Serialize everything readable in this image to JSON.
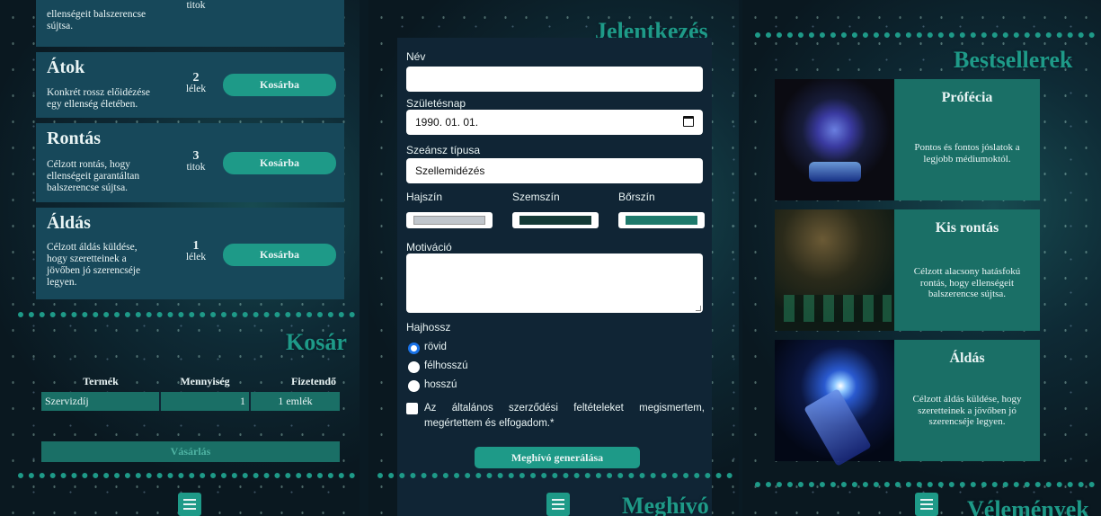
{
  "left": {
    "partial_card": {
      "desc": "ellenségeit balszerencse sújtsa.",
      "qty_unit": "titok"
    },
    "products": [
      {
        "name": "Átok",
        "desc": "Konkrét rossz előidézése egy ellenség életében.",
        "qty": "2",
        "unit": "lélek",
        "button": "Kosárba"
      },
      {
        "name": "Rontás",
        "desc": "Célzott rontás, hogy ellenségeit garantáltan balszerencse sújtsa.",
        "qty": "3",
        "unit": "titok",
        "button": "Kosárba"
      },
      {
        "name": "Áldás",
        "desc": "Célzott áldás küldése, hogy szeretteinek a jövőben jó szerencséje legyen.",
        "qty": "1",
        "unit": "lélek",
        "button": "Kosárba"
      }
    ],
    "cart": {
      "title": "Kosár",
      "headers": [
        "Termék",
        "Mennyiség",
        "Fizetendő"
      ],
      "rows": [
        [
          "Szervizdíj",
          "1",
          "1 emlék"
        ]
      ],
      "buy_button": "Vásárlás"
    }
  },
  "middle": {
    "title": "Jelentkezés",
    "fields": {
      "name_label": "Név",
      "name_value": "",
      "birth_label": "Születésnap",
      "birth_value": "1990. 01. 01.",
      "seance_label": "Szeánsz típusa",
      "seance_value": "Szellemidézés",
      "hair_label": "Hajszín",
      "eye_label": "Szemszín",
      "skin_label": "Bőrszín",
      "motivation_label": "Motiváció",
      "hairlen_label": "Hajhossz",
      "hair_options": [
        "rövid",
        "félhosszú",
        "hosszú"
      ],
      "terms": "Az általános szerződési feltételeket megismertem, megértettem és elfogadom.*",
      "submit": "Meghívó generálása"
    },
    "colors": {
      "hair": "#c0c6cc",
      "eye": "#143a36",
      "skin": "#1e7a6c"
    },
    "next_title": "Meghívó"
  },
  "right": {
    "title": "Bestsellerek",
    "items": [
      {
        "name": "Prófécia",
        "desc": "Pontos és fontos jóslatok a legjobb médiumoktól."
      },
      {
        "name": "Kis rontás",
        "desc": "Célzott alacsony hatásfokú rontás, hogy ellenségeit balszerencse sújtsa."
      },
      {
        "name": "Áldás",
        "desc": "Célzott áldás küldése, hogy szeretteinek a jövőben jó szerencséje legyen."
      }
    ],
    "next_title": "Vélemények"
  },
  "accent": "#1e9a88"
}
